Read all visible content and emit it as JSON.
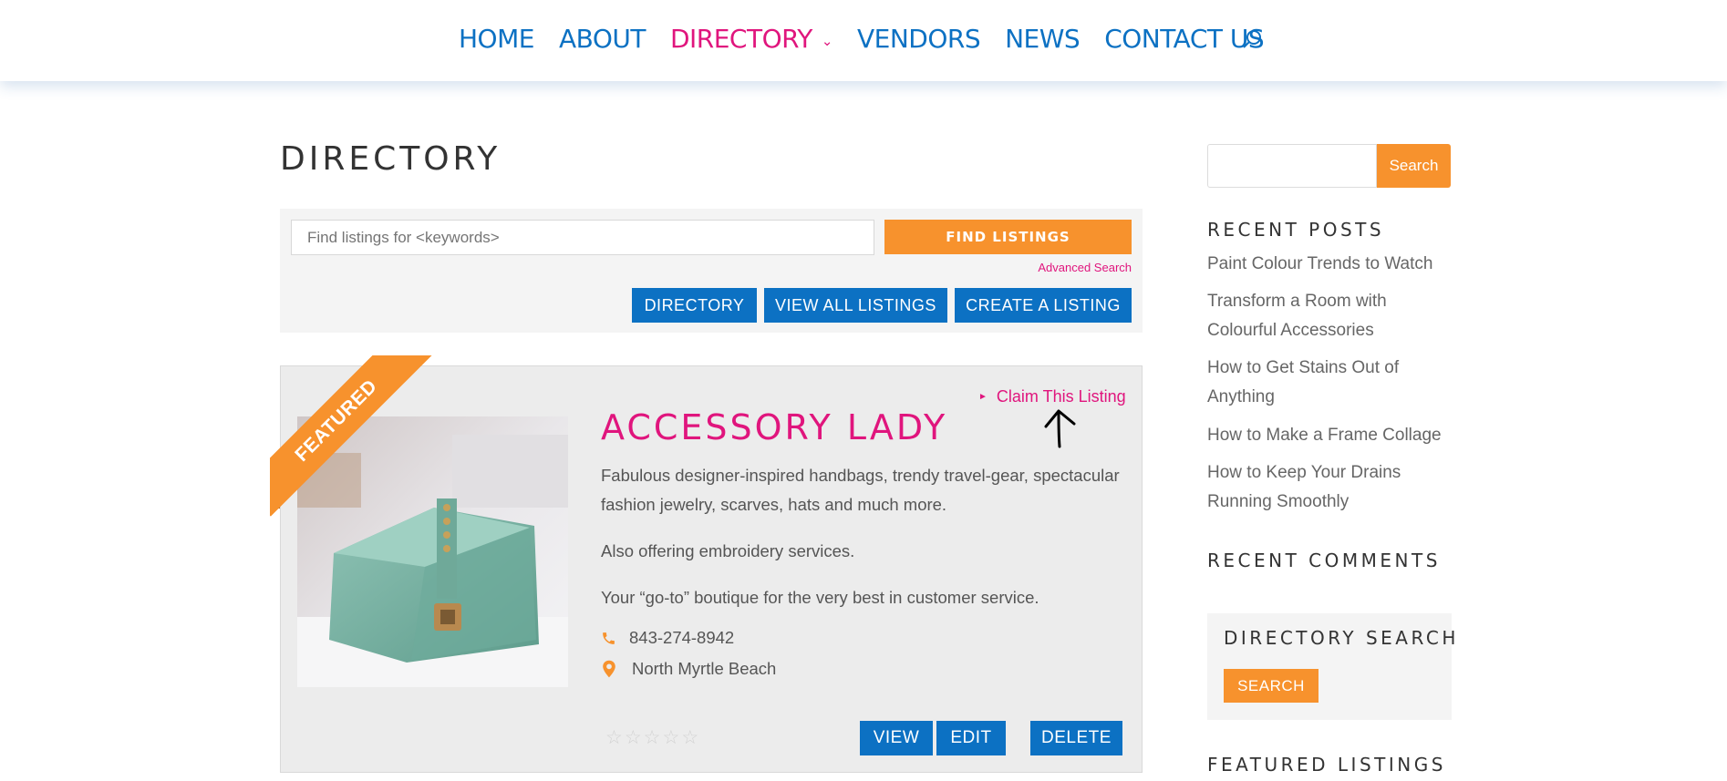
{
  "nav": {
    "items": [
      {
        "label": "HOME"
      },
      {
        "label": "ABOUT"
      },
      {
        "label": "DIRECTORY",
        "active": true
      },
      {
        "label": "VENDORS"
      },
      {
        "label": "NEWS"
      },
      {
        "label": "CONTACT US"
      }
    ],
    "search_icon": "search-icon"
  },
  "page": {
    "title": "DIRECTORY"
  },
  "search_panel": {
    "keywords_placeholder": "Find listings for <keywords>",
    "find_button": "FIND LISTINGS",
    "advanced_link": "Advanced Search",
    "buttons": [
      "DIRECTORY",
      "VIEW ALL LISTINGS",
      "CREATE A LISTING"
    ]
  },
  "listing": {
    "badge": "FEATURED",
    "claim_link": "Claim This Listing",
    "title": "ACCESSORY LADY",
    "description": [
      "Fabulous designer-inspired handbags, trendy travel-gear, spectacular fashion jewelry, scarves, hats and much more.",
      "Also offering embroidery services.",
      "Your “go-to” boutique for the very best in customer service."
    ],
    "phone": "843-274-8942",
    "location": "North Myrtle Beach",
    "rating": 0,
    "rating_max": 5,
    "actions": [
      "VIEW",
      "EDIT",
      "DELETE"
    ]
  },
  "sidebar": {
    "search_button": "Search",
    "recent_posts_title": "RECENT POSTS",
    "recent_posts": [
      "Paint Colour Trends to Watch",
      "Transform a Room with Colourful Accessories",
      "How to Get Stains Out of Anything",
      "How to Make a Frame Collage",
      "How to Keep Your Drains Running Smoothly"
    ],
    "recent_comments_title": "RECENT COMMENTS",
    "directory_search_title": "DIRECTORY SEARCH",
    "directory_search_button": "SEARCH",
    "featured_listings_title": "FEATURED LISTINGS"
  },
  "colors": {
    "primary_blue": "#0c71c3",
    "accent_pink": "#e0157d",
    "accent_orange": "#f7922d"
  }
}
